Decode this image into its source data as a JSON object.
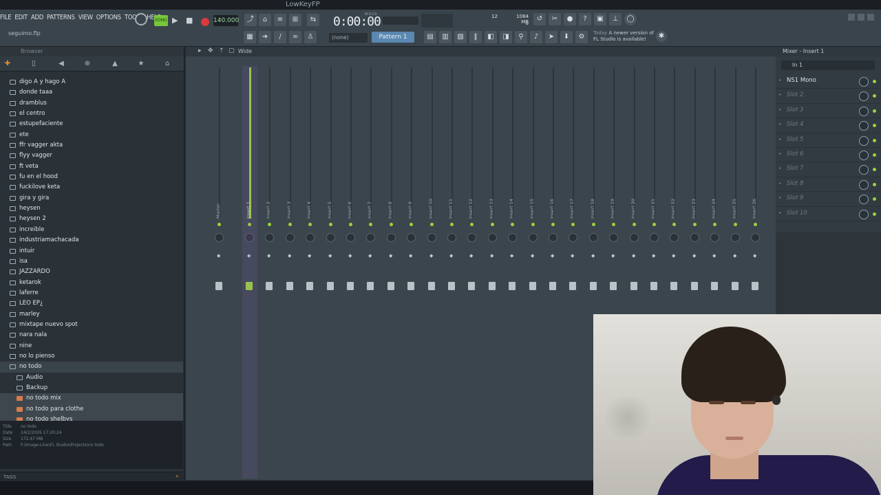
{
  "window": {
    "title": "LowKeyFP"
  },
  "menus": [
    "FILE",
    "EDIT",
    "ADD",
    "PATTERNS",
    "VIEW",
    "OPTIONS",
    "TOOLS",
    "HELP"
  ],
  "project_file": "seguimo.flp",
  "transport": {
    "mode_label": "SONG",
    "tempo": "140.000",
    "time": "0:00:00",
    "time_unit": "M:S:CS",
    "cpu": "12",
    "ram": "1084 MB",
    "voices": "0"
  },
  "pattern": {
    "preset_select": "(none)",
    "name": "Pattern 1"
  },
  "news": {
    "when": "Today",
    "message": "A newer version of FL Studio is available!"
  },
  "browser": {
    "header": "Browser",
    "tree": [
      {
        "label": "digo A y hago A",
        "type": "folder"
      },
      {
        "label": "donde taaa",
        "type": "folder"
      },
      {
        "label": "dramblus",
        "type": "folder"
      },
      {
        "label": "el centro",
        "type": "folder"
      },
      {
        "label": "estupefaciente",
        "type": "folder"
      },
      {
        "label": "ete",
        "type": "folder"
      },
      {
        "label": "ffr vagger akta",
        "type": "folder"
      },
      {
        "label": "flyy vagger",
        "type": "folder"
      },
      {
        "label": "ft veta",
        "type": "folder"
      },
      {
        "label": "fu en el hood",
        "type": "folder"
      },
      {
        "label": "fuckilove keta",
        "type": "folder"
      },
      {
        "label": "gira y gira",
        "type": "folder"
      },
      {
        "label": "heysen",
        "type": "folder"
      },
      {
        "label": "heysen 2",
        "type": "folder"
      },
      {
        "label": "increible",
        "type": "folder"
      },
      {
        "label": "industriamachacada",
        "type": "folder"
      },
      {
        "label": "intuir",
        "type": "folder"
      },
      {
        "label": "isa",
        "type": "folder"
      },
      {
        "label": "JAZZARDO",
        "type": "folder"
      },
      {
        "label": "ketarok",
        "type": "folder"
      },
      {
        "label": "laferre",
        "type": "folder"
      },
      {
        "label": "LEO EP¿",
        "type": "folder"
      },
      {
        "label": "marley",
        "type": "folder"
      },
      {
        "label": "mixtape nuevo spot",
        "type": "folder"
      },
      {
        "label": "nara nala",
        "type": "folder"
      },
      {
        "label": "nine",
        "type": "folder"
      },
      {
        "label": "no lo pienso",
        "type": "folder"
      },
      {
        "label": "no todo",
        "type": "folder-open"
      },
      {
        "label": "Audio",
        "type": "subfolder"
      },
      {
        "label": "Backup",
        "type": "subfolder"
      },
      {
        "label": "no todo mix",
        "type": "file"
      },
      {
        "label": "no todo para clothe",
        "type": "file"
      },
      {
        "label": "no todo shelbys",
        "type": "file"
      }
    ],
    "info": {
      "title_label": "Title",
      "title_value": "no todo",
      "date_label": "Date",
      "date_value": "24/2/2026 17:20:24",
      "size_label": "Size",
      "size_value": "172.47 MB",
      "path_label": "Path",
      "path_value": "F:\\Image-Line\\FL Studio\\Projects\\no todo"
    },
    "tags_label": "TAGS"
  },
  "mixer": {
    "title": "Mixer - Insert 1",
    "view_mode": "Wide",
    "input": "In 1",
    "strips": [
      "Master",
      "Insert 1",
      "Insert 2",
      "Insert 3",
      "Insert 4",
      "Insert 5",
      "Insert 6",
      "Insert 7",
      "Insert 8",
      "Insert 9",
      "Insert 10",
      "Insert 11",
      "Insert 12",
      "Insert 13",
      "Insert 14",
      "Insert 15",
      "Insert 16",
      "Insert 17",
      "Insert 18",
      "Insert 19",
      "Insert 20",
      "Insert 21",
      "Insert 22",
      "Insert 23",
      "Insert 24",
      "Insert 25",
      "Insert 26"
    ],
    "selected_strip": "Insert 1",
    "slots": [
      "NS1 Mono",
      "Slot 2",
      "Slot 3",
      "Slot 4",
      "Slot 5",
      "Slot 6",
      "Slot 7",
      "Slot 8",
      "Slot 9",
      "Slot 10"
    ]
  },
  "colors": {
    "accent_green": "#9ad33a",
    "accent_orange": "#f08a26",
    "record_red": "#d83a3a",
    "pattern_blue": "#5a88b0"
  }
}
